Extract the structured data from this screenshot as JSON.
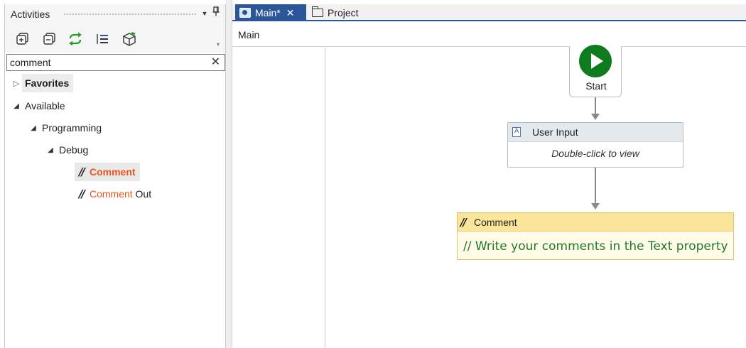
{
  "activities_panel": {
    "title": "Activities",
    "pin_glyph": "ѱ",
    "toolbar_icons": [
      "expand-all-icon",
      "collapse-all-icon",
      "refresh-icon",
      "show-list-icon",
      "package-icon"
    ],
    "search": {
      "value": "comment",
      "placeholder": ""
    },
    "tree": {
      "favorites": "Favorites",
      "available": "Available",
      "programming": "Programming",
      "debug": "Debug",
      "comment": "Comment",
      "comment_out_match": "Comment",
      "comment_out_rest": " Out"
    },
    "highlight_color": "#e8541c"
  },
  "designer": {
    "tabs": [
      {
        "label": "Main*",
        "active": true
      },
      {
        "label": "Project",
        "active": false
      }
    ],
    "breadcrumb": "Main",
    "start_label": "Start",
    "user_input": {
      "title": "User Input",
      "hint": "Double-click to view"
    },
    "comment": {
      "title": "Comment",
      "text": "// Write your comments in the Text property"
    },
    "accent_color": "#2b579a",
    "start_color": "#0f7b1f"
  }
}
